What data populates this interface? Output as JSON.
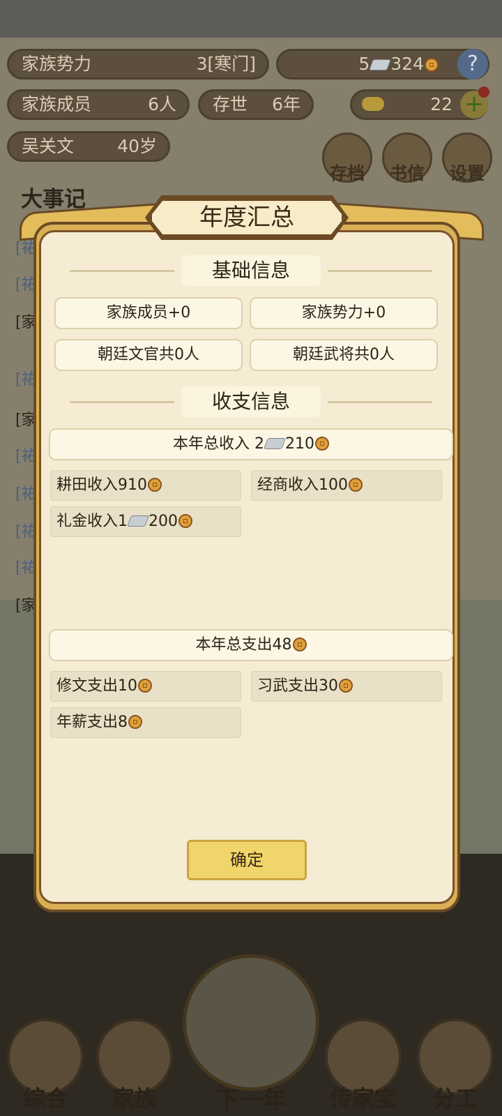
{
  "background": {
    "family_power_label": "家族势力",
    "family_power_value": "3[寒门]",
    "silver_count": "5",
    "coin_count": "324",
    "help_label": "?",
    "members_label": "家族成员",
    "members_value": "6人",
    "exist_label": "存世",
    "exist_value": "6年",
    "gold_count": "22",
    "plus_label": "+",
    "person_name": "吴关文",
    "person_age": "40岁",
    "save_label": "存档",
    "letter_label": "书信",
    "settings_label": "设置",
    "events_title": "大事记",
    "event_lines": [
      "[祐",
      "[祐",
      "[家",
      "[祐",
      "[家",
      "[祐",
      "[祐",
      "[祐",
      "[祐",
      "[家"
    ],
    "nav": [
      "综合",
      "家族",
      "下一年",
      "传家宝",
      "分工"
    ]
  },
  "dialog": {
    "title": "年度汇总",
    "basic_section": "基础信息",
    "basic_items": [
      "家族成员+0",
      "家族势力+0",
      "朝廷文官共0人",
      "朝廷武将共0人"
    ],
    "finance_section": "收支信息",
    "income_total": {
      "prefix": "本年总收入 2",
      "suffix": "210"
    },
    "income_items": {
      "farming": "耕田收入910",
      "business": "经商收入100",
      "gift_prefix": "礼金收入1",
      "gift_suffix": "200"
    },
    "expense_total": "本年总支出48",
    "expense_items": {
      "study": "修文支出10",
      "martial": "习武支出30",
      "salary": "年薪支出8"
    },
    "confirm_label": "确定"
  }
}
